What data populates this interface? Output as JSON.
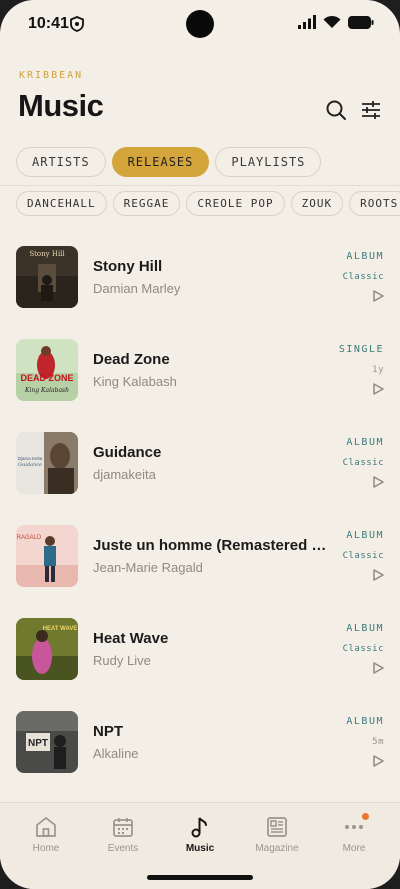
{
  "status": {
    "time": "10:41"
  },
  "header": {
    "brand": "KRIBBEAN",
    "title": "Music"
  },
  "tabs": [
    {
      "label": "ARTISTS",
      "active": false
    },
    {
      "label": "RELEASES",
      "active": true
    },
    {
      "label": "PLAYLISTS",
      "active": false
    }
  ],
  "genres": [
    "DANCEHALL",
    "REGGAE",
    "CREOLE POP",
    "ZOUK",
    "ROOTS"
  ],
  "releases": [
    {
      "title": "Stony Hill",
      "artist": "Damian Marley",
      "type": "ALBUM",
      "tag": "Classic",
      "cover_text": "Stony Hill"
    },
    {
      "title": "Dead Zone",
      "artist": "King Kalabash",
      "type": "SINGLE",
      "tag": "1y",
      "cover_text": "DEAD ZONE"
    },
    {
      "title": "Guidance",
      "artist": "djamakeita",
      "type": "ALBUM",
      "tag": "Classic",
      "cover_text": "Djama Keita"
    },
    {
      "title": "Juste un homme (Remastered del...",
      "artist": "Jean-Marie Ragald",
      "type": "ALBUM",
      "tag": "Classic",
      "cover_text": "RAGALD"
    },
    {
      "title": "Heat Wave",
      "artist": "Rudy Live",
      "type": "ALBUM",
      "tag": "Classic",
      "cover_text": "HEAT WAVE"
    },
    {
      "title": "NPT",
      "artist": "Alkaline",
      "type": "ALBUM",
      "tag": "5m",
      "cover_text": "NPT"
    }
  ],
  "nav": [
    {
      "label": "Home",
      "icon": "home-icon"
    },
    {
      "label": "Events",
      "icon": "calendar-icon"
    },
    {
      "label": "Music",
      "icon": "music-note-icon",
      "active": true
    },
    {
      "label": "Magazine",
      "icon": "newspaper-icon"
    },
    {
      "label": "More",
      "icon": "more-dots-icon",
      "badge": true
    }
  ],
  "colors": {
    "accent": "#d4a53a",
    "teal": "#3c7a7a",
    "background": "#f4efe6",
    "badge": "#e8782e"
  }
}
